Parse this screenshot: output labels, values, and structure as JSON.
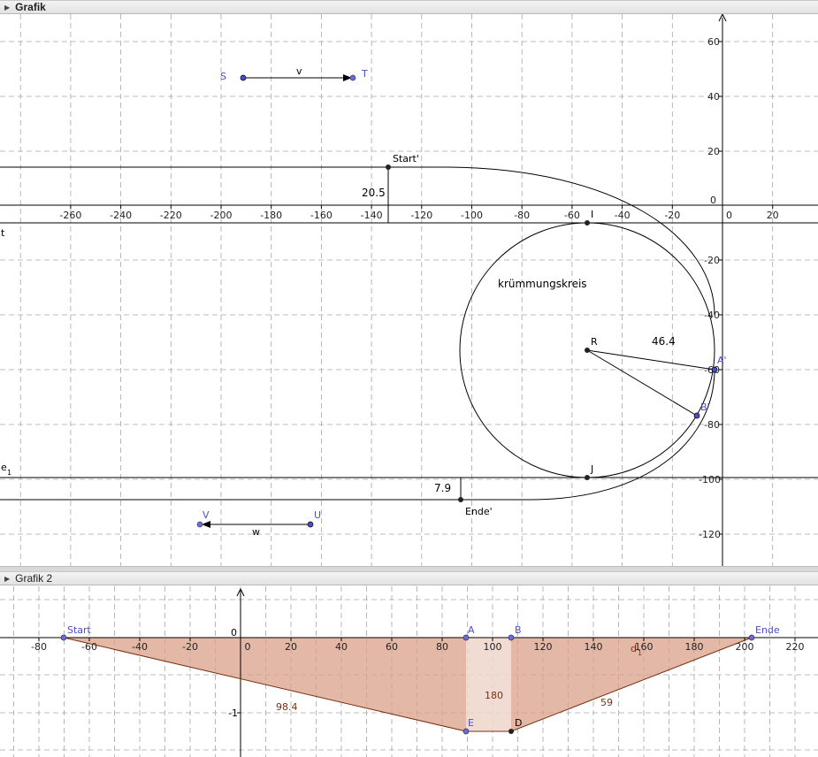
{
  "panels": {
    "graphics1": {
      "title": "Grafik"
    },
    "graphics2": {
      "title": "Grafik 2"
    }
  },
  "colors": {
    "grid": "#a6a6a6",
    "axis": "#000000",
    "point_black": "#222222",
    "point_blue": "#4d4dcc",
    "label_blue": "#4d4dcc",
    "fill_region": "#d9a08a",
    "fill_strip": "#eed6cc",
    "label_brown": "#7a3010"
  },
  "view1": {
    "x_ticks": [
      "-260",
      "-240",
      "-220",
      "-200",
      "-180",
      "-160",
      "-140",
      "-120",
      "-100",
      "-80",
      "-60",
      "-40",
      "-20",
      "0",
      "20"
    ],
    "y_ticks_pos": [
      "60",
      "40",
      "20"
    ],
    "y_ticks_neg": [
      "-20",
      "-40",
      "-60",
      "-80",
      "-100",
      "-120"
    ],
    "origin_label": "0",
    "vector_v": {
      "from": "S",
      "to": "T",
      "label": "v"
    },
    "vector_w": {
      "from": "U",
      "to": "V",
      "label": "w"
    },
    "point_labels": {
      "S": "S",
      "T": "T",
      "U": "U",
      "V": "V",
      "start": "Start'",
      "ende": "Ende'",
      "I": "I",
      "J": "J",
      "R": "R",
      "A": "A'",
      "B": "B'"
    },
    "line_labels": {
      "t": "t",
      "e": "e",
      "e_sub": "1"
    },
    "values": {
      "start_height": "20.5",
      "end_height": "7.9",
      "radius": "46.4"
    },
    "circle_label": "krümmungskreis"
  },
  "view2": {
    "x_ticks": [
      "-80",
      "-60",
      "-40",
      "-20",
      "0",
      "20",
      "40",
      "60",
      "80",
      "100",
      "120",
      "140",
      "160",
      "180",
      "200",
      "220"
    ],
    "y_ticks": [
      "0",
      "-1"
    ],
    "point_labels": {
      "start": "Start",
      "A": "A",
      "B": "B",
      "ende": "Ende",
      "E": "E",
      "D": "D"
    },
    "segment_labels": {
      "left": "98.4",
      "middle": "180",
      "right": "59",
      "d": "d",
      "d_sub": "1"
    }
  }
}
